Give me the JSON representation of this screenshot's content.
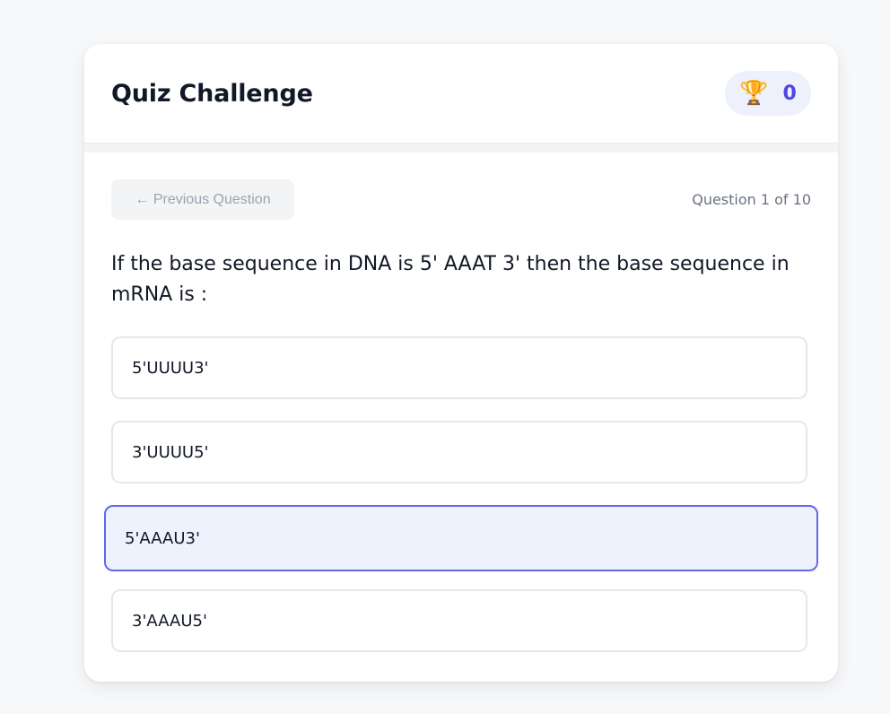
{
  "header": {
    "title": "Quiz Challenge",
    "score": "0",
    "score_icon": "trophy-icon"
  },
  "nav": {
    "prev_label": "← Previous Question",
    "progress": "Question 1 of 10"
  },
  "question": {
    "text": "If the base sequence in DNA is 5' AAAT 3' then the base sequence in mRNA is :"
  },
  "options": [
    {
      "label": "5'UUUU3'",
      "selected": false
    },
    {
      "label": "3'UUUU5'",
      "selected": false
    },
    {
      "label": "5'AAAU3'",
      "selected": true
    },
    {
      "label": "3'AAAU5'",
      "selected": false
    }
  ],
  "colors": {
    "accent": "#6366f1",
    "score": "#4f46e5",
    "selected_bg": "#eef2fd"
  }
}
